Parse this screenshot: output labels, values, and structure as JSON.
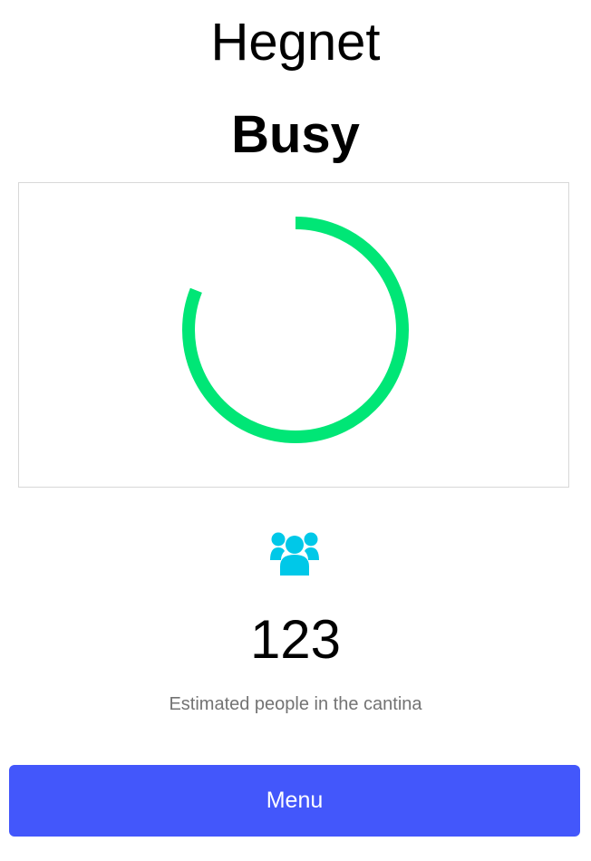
{
  "header": {
    "title": "Hegnet",
    "status": "Busy"
  },
  "occupancy": {
    "gauge_fraction": 0.81,
    "gauge_color": "#00e676",
    "icon": "people-group-icon",
    "icon_color": "#00c8e8",
    "count": "123",
    "caption": "Estimated people in the cantina"
  },
  "menu_button": {
    "label": "Menu",
    "color": "#4357fb"
  }
}
